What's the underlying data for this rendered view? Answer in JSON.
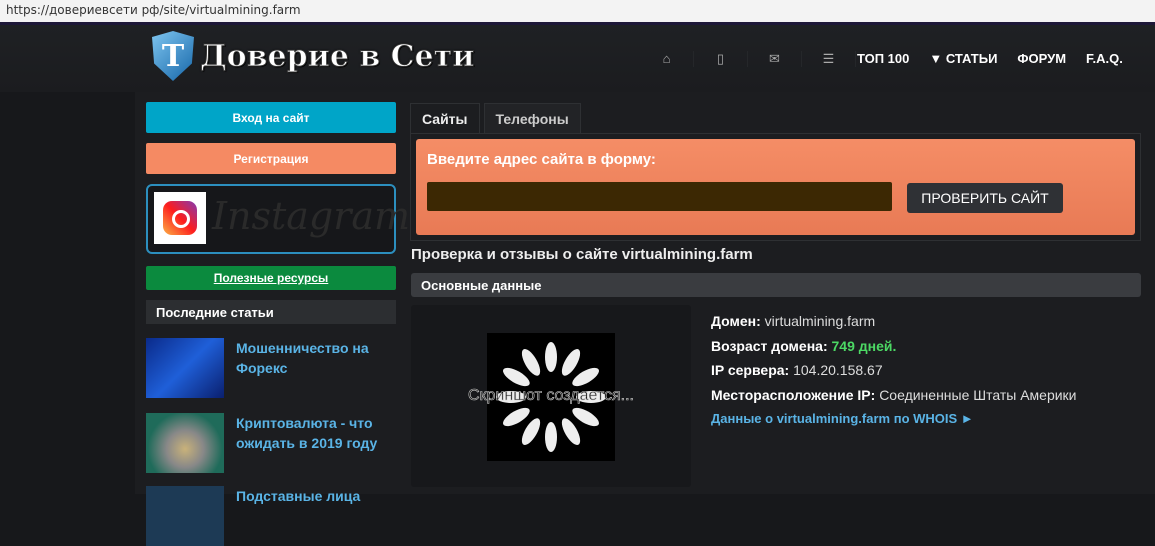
{
  "browser": {
    "url": "https://довериевсети рф/site/virtualmining.farm"
  },
  "header": {
    "logo_text": "Доверие в Сети",
    "logo_letter": "T",
    "nav_icons": [
      "home-icon",
      "phone-icon",
      "mail-icon",
      "list-icon"
    ],
    "nav_links": [
      "ТОП 100",
      "▼ СТАТЬИ",
      "ФОРУМ",
      "F.A.Q."
    ]
  },
  "sidebar": {
    "login": "Вход на сайт",
    "register": "Регистрация",
    "instagram": "Instagram",
    "resources": "Полезные ресурсы",
    "latest_title": "Последние статьи",
    "articles": [
      {
        "title": "Мошенничество на Форекс"
      },
      {
        "title": "Криптовалюта - что ожидать в 2019 году"
      },
      {
        "title": "Подставные лица"
      }
    ]
  },
  "main": {
    "tabs": [
      "Сайты",
      "Телефоны"
    ],
    "form_label": "Введите адрес сайта в форму:",
    "input_value": "",
    "check_button": "ПРОВЕРИТЬ САЙТ",
    "page_title": "Проверка и отзывы о сайте virtualmining.farm",
    "section": "Основные данные",
    "screenshot_text": "Скриншот создается...",
    "info": {
      "domain_label": "Домен:",
      "domain": "virtualmining.farm",
      "age_label": "Возраст домена:",
      "age": "749 дней.",
      "ip_label": "IP сервера:",
      "ip": "104.20.158.67",
      "loc_label": "Месторасположение IP:",
      "loc": "Соединенные Штаты Америки",
      "whois": "Данные о virtualmining.farm по WHOIS ►"
    }
  },
  "colors": {
    "login": "#00a5c8",
    "register": "#f58a63",
    "resources": "#0b8a3e",
    "link": "#5ab4e6",
    "green": "#4cd964"
  }
}
